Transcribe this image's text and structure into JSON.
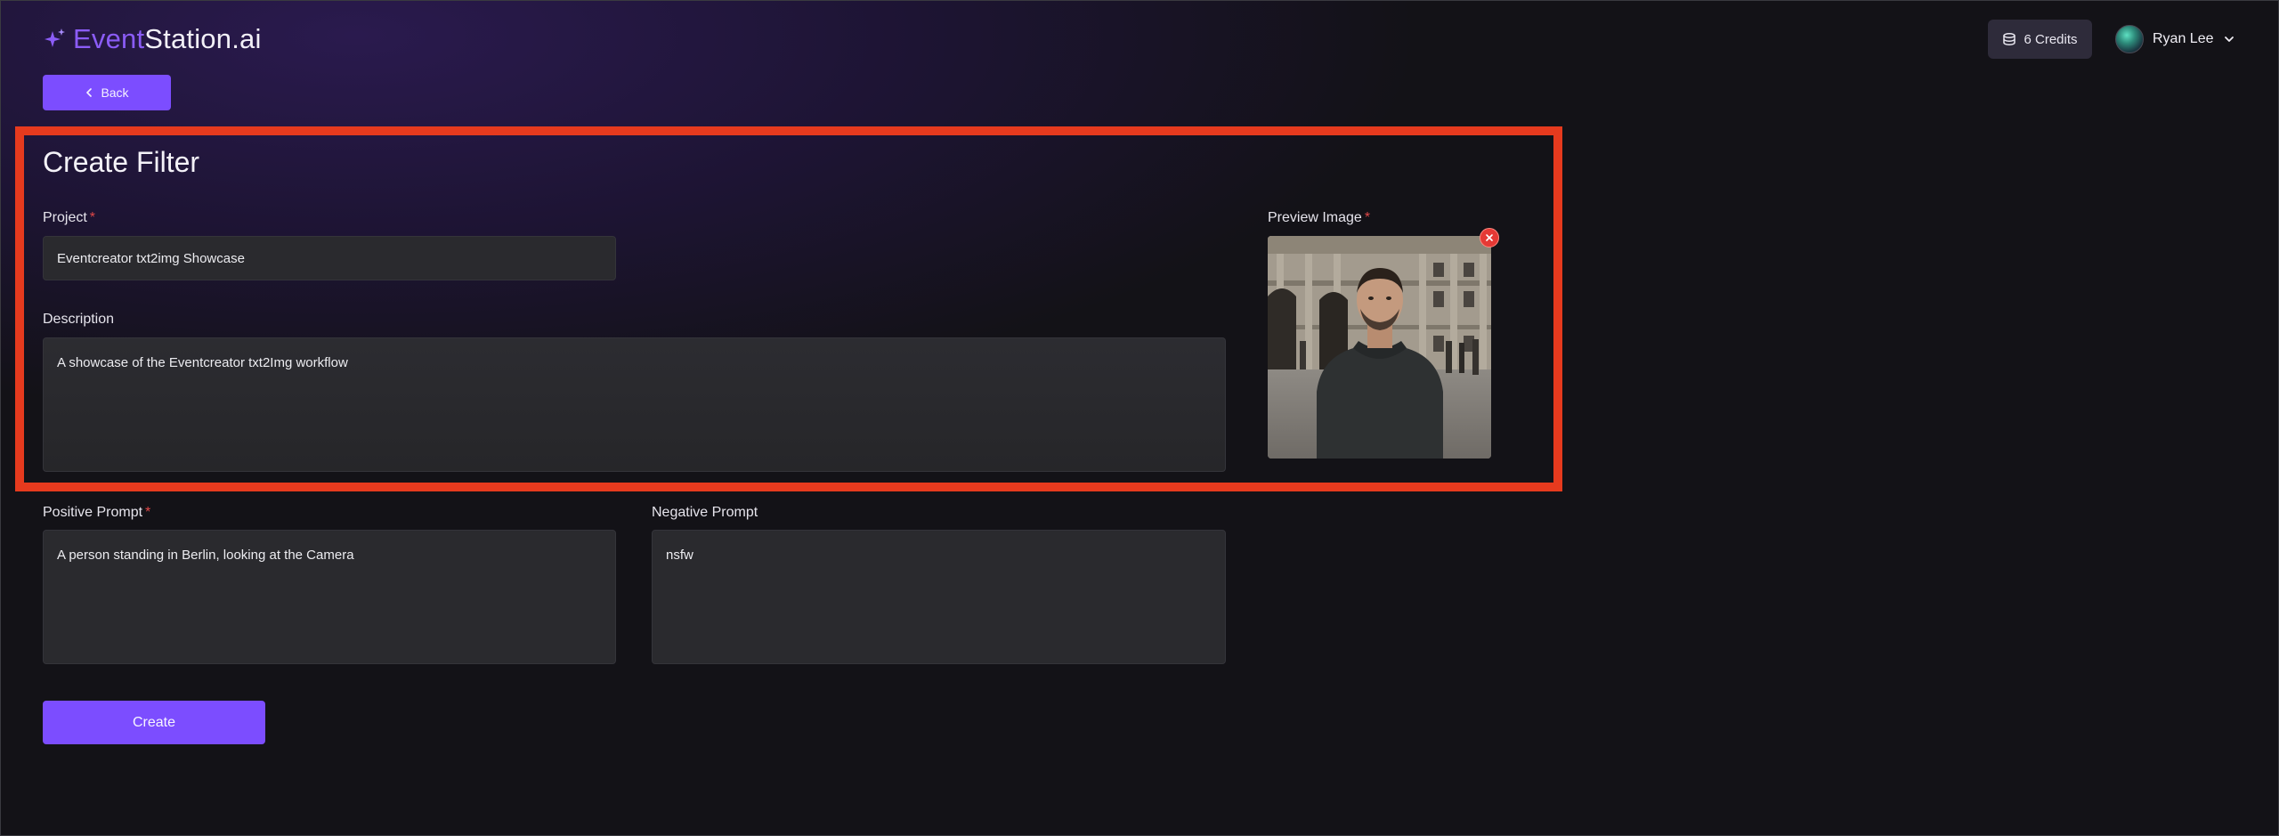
{
  "header": {
    "logo_event": "Event",
    "logo_station": "Station.ai",
    "credits_label": "6 Credits",
    "user_name": "Ryan Lee"
  },
  "nav": {
    "back_label": "Back"
  },
  "page": {
    "title": "Create Filter"
  },
  "form": {
    "project_label": "Project",
    "project_value": "Eventcreator txt2img Showcase",
    "description_label": "Description",
    "description_value": "A showcase of the Eventcreator txt2Img workflow",
    "preview_label": "Preview Image",
    "positive_label": "Positive Prompt",
    "positive_value": "A person standing in Berlin, looking at the Camera",
    "negative_label": "Negative Prompt",
    "negative_value": "nsfw",
    "required_mark": "*",
    "create_label": "Create"
  },
  "icons": {
    "logo": "sparkle-icon",
    "credits": "coins-icon",
    "user_menu": "chevron-down-icon",
    "back": "chevron-left-icon",
    "remove_preview": "close-icon"
  },
  "colors": {
    "accent": "#7c4dff",
    "brand_purple": "#8b5cf6",
    "required": "#e04848",
    "remove": "#e53935",
    "highlight": "#e63a1e"
  }
}
